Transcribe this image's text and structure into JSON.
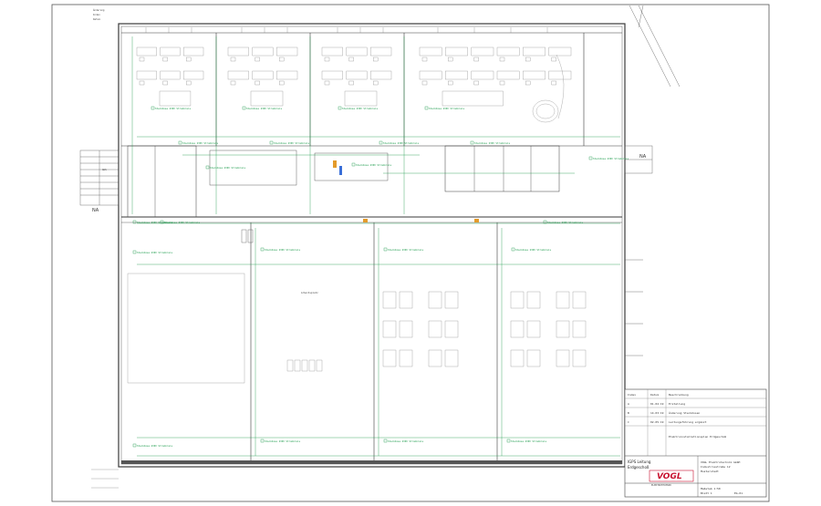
{
  "revision_notes": [
    "Änderung",
    "Index",
    "Datum"
  ],
  "area_labels": {
    "left": "NA",
    "right": "NA"
  },
  "stair_label": "AUS",
  "circuit_tag": "Steckdose 230V Stromkreis",
  "room_annotation": "Arbeitsplatz",
  "title_block": {
    "project_lines": [
      "IGPS Leitung",
      "Erdgeschoß"
    ],
    "company_line": "VOGL Elektrotechnik GmbH",
    "address_lines": [
      "Industriestraße 12",
      "Musterstadt"
    ],
    "logo_text": "VOGL",
    "logo_subtitle": "ELEKTROTECHNIK",
    "plan_name": "Elektroinstallationsplan Erdgeschoß",
    "rows": [
      {
        "a": "Index",
        "b": "Datum",
        "c": "Beschreibung"
      },
      {
        "a": "A",
        "b": "01.02.19",
        "c": "Erstellung"
      },
      {
        "a": "B",
        "b": "14.03.19",
        "c": "Änderung Steckdosen"
      },
      {
        "a": "C",
        "b": "02.05.19",
        "c": "Leitungsführung ergänzt"
      }
    ],
    "footer": [
      "Maßstab 1:50",
      "Blatt 1",
      "EG-01"
    ]
  },
  "colors": {
    "ink": "#3a3a3a",
    "green": "#1a9a4a",
    "red": "#c8102e",
    "orange": "#e39b2b",
    "blue": "#3a6fd8"
  }
}
